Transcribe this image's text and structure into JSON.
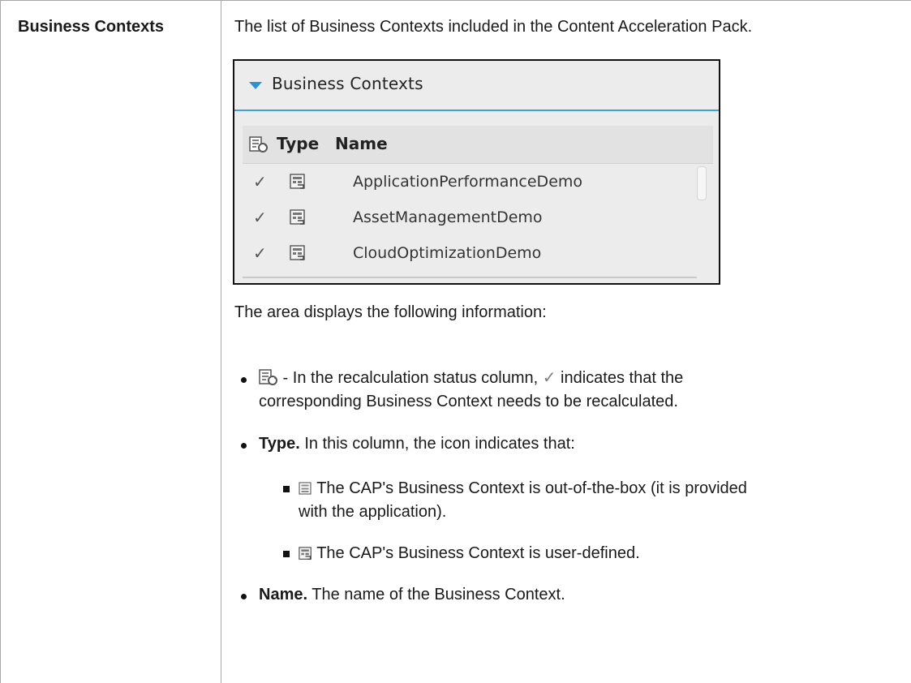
{
  "term": "Business Contexts",
  "description": "The list of Business Contexts included in the Content Acceleration Pack.",
  "screenshot": {
    "panel_title": "Business Contexts",
    "columns": {
      "type": "Type",
      "name": "Name"
    },
    "rows": [
      {
        "check": "✓",
        "name": "ApplicationPerformanceDemo"
      },
      {
        "check": "✓",
        "name": "AssetManagementDemo"
      },
      {
        "check": "✓",
        "name": "CloudOptimizationDemo"
      }
    ]
  },
  "intro": "The area displays the following information:",
  "bullets": {
    "recalc": {
      "lead": " - In the recalculation status column, ",
      "check": "✓",
      "line1_rest": " indicates that the",
      "line2": "corresponding Business Context needs to be recalculated."
    },
    "type": {
      "label": "Type.",
      "text": " In this column, the icon indicates that:",
      "sub1_line1": " The CAP's Business Context is out-of-the-box (it is provided",
      "sub1_line2": "with the application).",
      "sub2": " The CAP's Business Context is user-defined."
    },
    "name": {
      "label": "Name.",
      "text": " The name of the Business Context."
    }
  }
}
